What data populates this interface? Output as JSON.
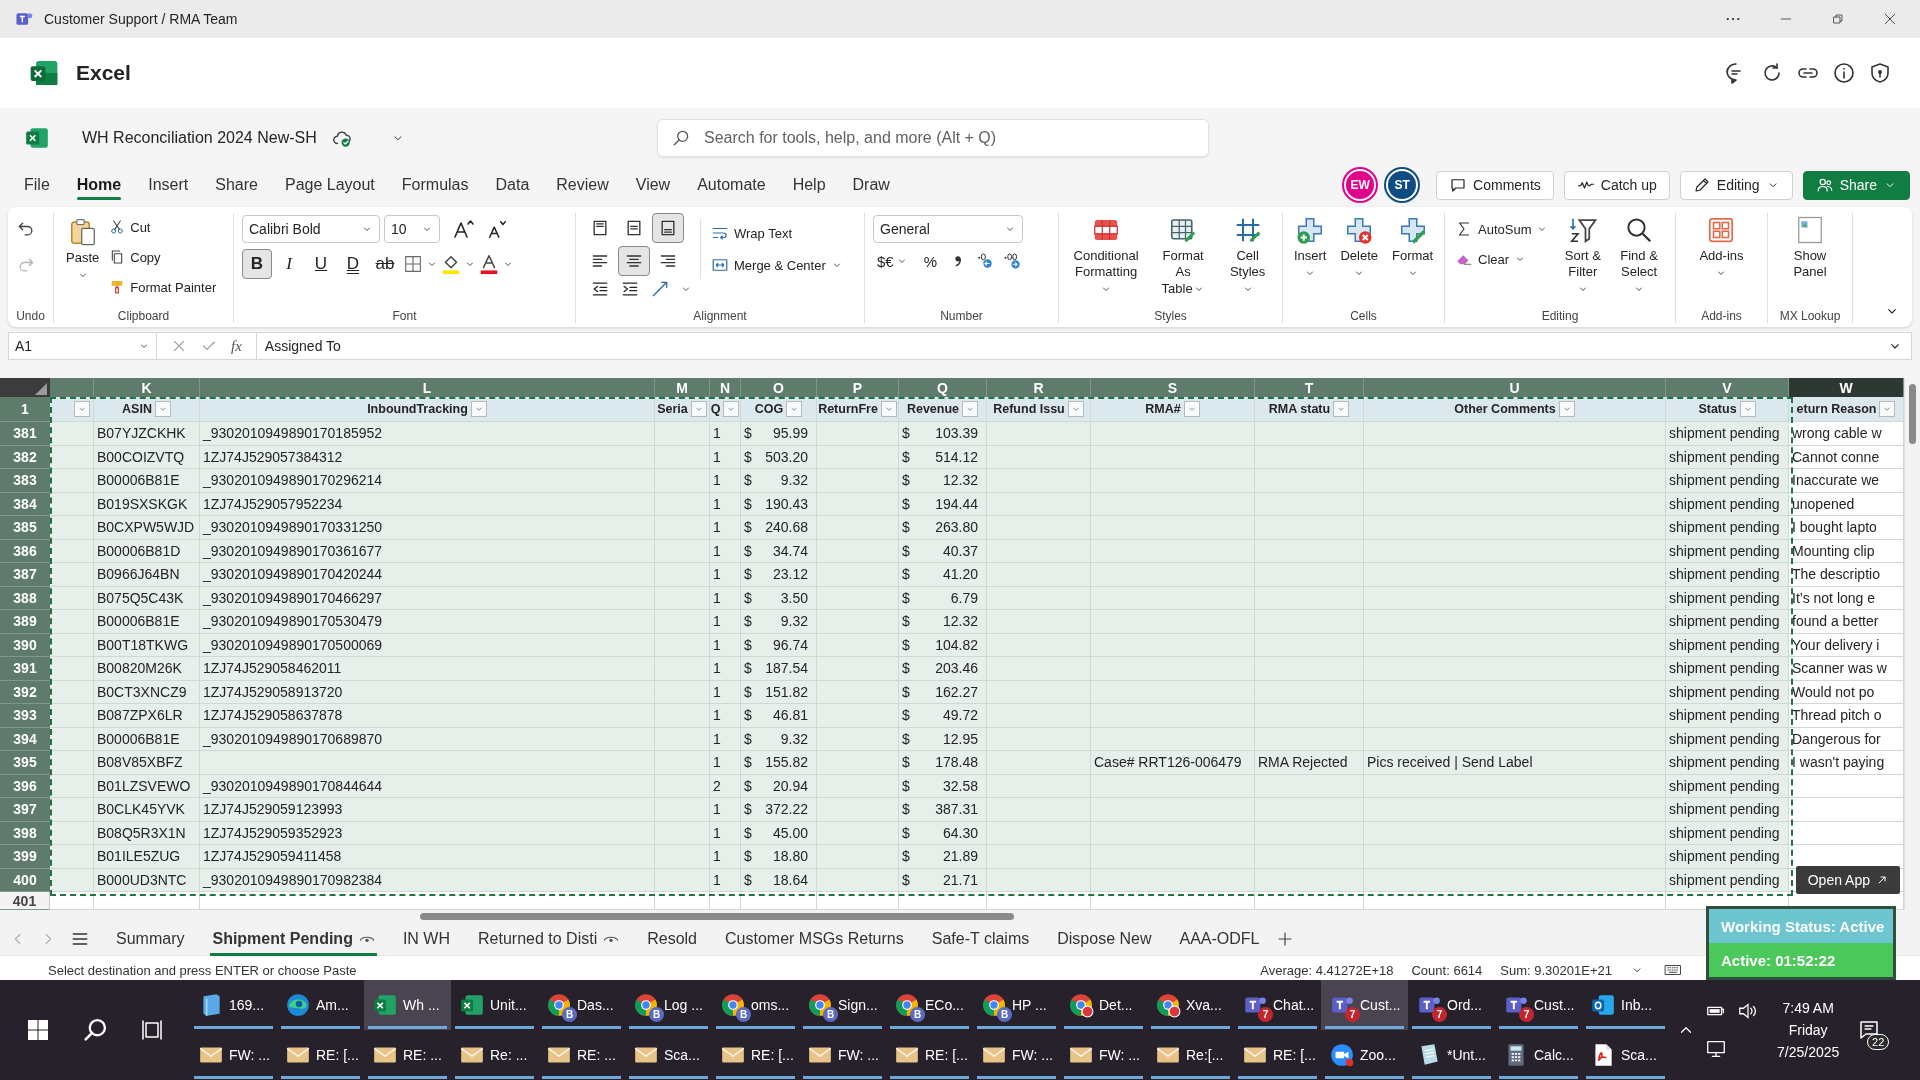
{
  "title_bar": {
    "title": "Customer Support / RMA Team"
  },
  "app_header": {
    "app_name": "Excel"
  },
  "file_bar": {
    "file_name": "WH Reconciliation 2024 New-SH",
    "search": {
      "placeholder": "Search for tools, help, and more (Alt + Q)"
    }
  },
  "menu_tabs": [
    {
      "label": "File",
      "selected": false
    },
    {
      "label": "Home",
      "selected": true
    },
    {
      "label": "Insert",
      "selected": false
    },
    {
      "label": "Share",
      "selected": false
    },
    {
      "label": "Page Layout",
      "selected": false
    },
    {
      "label": "Formulas",
      "selected": false
    },
    {
      "label": "Data",
      "selected": false
    },
    {
      "label": "Review",
      "selected": false
    },
    {
      "label": "View",
      "selected": false
    },
    {
      "label": "Automate",
      "selected": false
    },
    {
      "label": "Help",
      "selected": false
    },
    {
      "label": "Draw",
      "selected": false
    }
  ],
  "collaborators": [
    {
      "initials": "EW",
      "color": "#e3008c"
    },
    {
      "initials": "ST",
      "color": "#0f4c81"
    }
  ],
  "header_buttons": [
    {
      "kind": "comments",
      "label": "Comments"
    },
    {
      "kind": "catchup",
      "label": "Catch up"
    },
    {
      "kind": "editing",
      "label": "Editing"
    },
    {
      "kind": "share",
      "label": "Share"
    }
  ],
  "ribbon": {
    "groups": [
      {
        "kind": "undo",
        "label": "Undo",
        "redo_disabled": true
      },
      {
        "kind": "clipboard",
        "label": "Clipboard",
        "paste": "Paste",
        "items": [
          {
            "kind": "cut",
            "label": "Cut"
          },
          {
            "kind": "copy",
            "label": "Copy"
          },
          {
            "kind": "painter",
            "label": "Format Painter"
          }
        ]
      },
      {
        "kind": "font",
        "label": "Font",
        "font_name": "Calibri Bold",
        "font_size": "10",
        "format_buttons": [
          {
            "kind": "bold",
            "label": "B",
            "selected": true
          },
          {
            "kind": "italic",
            "label": "I",
            "selected": false
          },
          {
            "kind": "underline",
            "label": "U",
            "selected": false
          },
          {
            "kind": "double_underline",
            "label": "D",
            "selected": false
          },
          {
            "kind": "strike",
            "label": "ab",
            "selected": false
          }
        ]
      },
      {
        "kind": "alignment",
        "label": "Alignment",
        "vertical": [
          {
            "kind": "top",
            "selected": false
          },
          {
            "kind": "middle",
            "selected": false
          },
          {
            "kind": "bottom",
            "selected": true
          }
        ],
        "horizontal": [
          {
            "kind": "left",
            "selected": false
          },
          {
            "kind": "center",
            "selected": true
          },
          {
            "kind": "right",
            "selected": false
          }
        ],
        "wrap": "Wrap Text",
        "merge": "Merge & Center"
      },
      {
        "kind": "number",
        "label": "Number",
        "format": "General",
        "currency": "$€",
        "percent": "%"
      },
      {
        "kind": "large",
        "label": "Styles",
        "buttons": [
          {
            "kind": "conditional",
            "label": "Conditional\nFormatting"
          },
          {
            "kind": "table",
            "label": "Format As\nTable"
          },
          {
            "kind": "cellstyles",
            "label": "Cell\nStyles"
          }
        ]
      },
      {
        "kind": "large",
        "label": "Cells",
        "buttons": [
          {
            "kind": "insert",
            "label": "Insert"
          },
          {
            "kind": "delete",
            "label": "Delete"
          },
          {
            "kind": "format",
            "label": "Format"
          }
        ]
      },
      {
        "kind": "editing",
        "label": "Editing",
        "small": [
          {
            "kind": "autosum",
            "label": "AutoSum"
          },
          {
            "kind": "clear",
            "label": "Clear"
          }
        ],
        "buttons": [
          {
            "kind": "sort",
            "label": "Sort &\nFilter"
          },
          {
            "kind": "find",
            "label": "Find &\nSelect"
          }
        ]
      },
      {
        "kind": "large",
        "label": "Add-ins",
        "buttons": [
          {
            "kind": "addins",
            "label": "Add-ins"
          }
        ]
      },
      {
        "kind": "large",
        "label": "MX Lookup",
        "buttons": [
          {
            "kind": "panel",
            "label": "Show\nPanel"
          }
        ]
      }
    ]
  },
  "formula_bar": {
    "name_box": "A1",
    "function_label": "fx",
    "content": "Assigned To"
  },
  "sheet": {
    "columns": [
      {
        "kind": "text",
        "selected": true
      },
      {
        "letter": "K",
        "header": "ASIN",
        "kind": "text",
        "selected": true
      },
      {
        "letter": "L",
        "header": "InboundTracking",
        "kind": "text",
        "selected": true
      },
      {
        "letter": "M",
        "header": "Seria",
        "kind": "text",
        "selected": true
      },
      {
        "letter": "N",
        "header": "Q",
        "kind": "text",
        "selected": true
      },
      {
        "letter": "O",
        "header": "COG",
        "kind": "currency",
        "selected": true
      },
      {
        "letter": "P",
        "header": "ReturnFre",
        "kind": "text",
        "selected": true
      },
      {
        "letter": "Q",
        "header": "Revenue",
        "kind": "currency",
        "selected": true
      },
      {
        "letter": "R",
        "header": "Refund Issu",
        "kind": "text",
        "selected": true
      },
      {
        "letter": "S",
        "header": "RMA#",
        "kind": "text",
        "selected": true
      },
      {
        "letter": "T",
        "header": "RMA statu",
        "kind": "text",
        "selected": true
      },
      {
        "letter": "U",
        "header": "Other Comments",
        "kind": "text",
        "selected": true
      },
      {
        "letter": "V",
        "header": "Status",
        "kind": "text",
        "selected": true
      },
      {
        "letter": "W",
        "header": "eturn Reason",
        "kind": "text",
        "selected": false
      }
    ],
    "header_row": "1",
    "rows": [
      {
        "num": "381",
        "selected": true,
        "asin": "B07YJZCKHK",
        "tracking": "_9302010949890170185952",
        "qty": "1",
        "cog_currency": "$",
        "cog": "95.99",
        "revenue_currency": "$",
        "revenue": "103.39",
        "status": "shipment pending",
        "reason": "wrong cable w"
      },
      {
        "num": "382",
        "selected": true,
        "asin": "B00COIZVTQ",
        "tracking": "1ZJ74J529057384312",
        "qty": "1",
        "cog_currency": "$",
        "cog": "503.20",
        "revenue_currency": "$",
        "revenue": "514.12",
        "status": "shipment pending",
        "reason": "Cannot conne"
      },
      {
        "num": "383",
        "selected": true,
        "asin": "B00006B81E",
        "tracking": "_9302010949890170296214",
        "qty": "1",
        "cog_currency": "$",
        "cog": "9.32",
        "revenue_currency": "$",
        "revenue": "12.32",
        "status": "shipment pending",
        "reason": "Inaccurate we"
      },
      {
        "num": "384",
        "selected": true,
        "asin": "B019SXSKGK",
        "tracking": "1ZJ74J529057952234",
        "qty": "1",
        "cog_currency": "$",
        "cog": "190.43",
        "revenue_currency": "$",
        "revenue": "194.44",
        "status": "shipment pending",
        "reason": "unopened"
      },
      {
        "num": "385",
        "selected": true,
        "asin": "B0CXPW5WJD",
        "tracking": "_9302010949890170331250",
        "qty": "1",
        "cog_currency": "$",
        "cog": "240.68",
        "revenue_currency": "$",
        "revenue": "263.80",
        "status": "shipment pending",
        "reason": "I bought lapto"
      },
      {
        "num": "386",
        "selected": true,
        "asin": "B00006B81D",
        "tracking": "_9302010949890170361677",
        "qty": "1",
        "cog_currency": "$",
        "cog": "34.74",
        "revenue_currency": "$",
        "revenue": "40.37",
        "status": "shipment pending",
        "reason": "Mounting clip"
      },
      {
        "num": "387",
        "selected": true,
        "asin": "B0966J64BN",
        "tracking": "_9302010949890170420244",
        "qty": "1",
        "cog_currency": "$",
        "cog": "23.12",
        "revenue_currency": "$",
        "revenue": "41.20",
        "status": "shipment pending",
        "reason": "The descriptio"
      },
      {
        "num": "388",
        "selected": true,
        "asin": "B075Q5C43K",
        "tracking": "_9302010949890170466297",
        "qty": "1",
        "cog_currency": "$",
        "cog": "3.50",
        "revenue_currency": "$",
        "revenue": "6.79",
        "status": "shipment pending",
        "reason": "It’s not long e"
      },
      {
        "num": "389",
        "selected": true,
        "asin": "B00006B81E",
        "tracking": "_9302010949890170530479",
        "qty": "1",
        "cog_currency": "$",
        "cog": "9.32",
        "revenue_currency": "$",
        "revenue": "12.32",
        "status": "shipment pending",
        "reason": "found a better"
      },
      {
        "num": "390",
        "selected": true,
        "asin": "B00T18TKWG",
        "tracking": "_9302010949890170500069",
        "qty": "1",
        "cog_currency": "$",
        "cog": "96.74",
        "revenue_currency": "$",
        "revenue": "104.82",
        "status": "shipment pending",
        "reason": "Your delivery i"
      },
      {
        "num": "391",
        "selected": true,
        "asin": "B00820M26K",
        "tracking": "1ZJ74J529058462011",
        "qty": "1",
        "cog_currency": "$",
        "cog": "187.54",
        "revenue_currency": "$",
        "revenue": "203.46",
        "status": "shipment pending",
        "reason": "Scanner was w"
      },
      {
        "num": "392",
        "selected": true,
        "asin": "B0CT3XNCZ9",
        "tracking": "1ZJ74J529058913720",
        "qty": "1",
        "cog_currency": "$",
        "cog": "151.82",
        "revenue_currency": "$",
        "revenue": "162.27",
        "status": "shipment pending",
        "reason": "Would not po"
      },
      {
        "num": "393",
        "selected": true,
        "asin": "B087ZPX6LR",
        "tracking": "1ZJ74J529058637878",
        "qty": "1",
        "cog_currency": "$",
        "cog": "46.81",
        "revenue_currency": "$",
        "revenue": "49.72",
        "status": "shipment pending",
        "reason": "Thread pitch o"
      },
      {
        "num": "394",
        "selected": true,
        "asin": "B00006B81E",
        "tracking": "_9302010949890170689870",
        "qty": "1",
        "cog_currency": "$",
        "cog": "9.32",
        "revenue_currency": "$",
        "revenue": "12.95",
        "status": "shipment pending",
        "reason": "Dangerous for"
      },
      {
        "num": "395",
        "selected": true,
        "asin": "B08V85XBFZ",
        "qty": "1",
        "cog_currency": "$",
        "cog": "155.82",
        "revenue_currency": "$",
        "revenue": "178.48",
        "rma": "Case# RRT126-006479",
        "rma_status": "RMA Rejected",
        "comments": "Pics received | Send Label",
        "status": "shipment pending",
        "reason": "I wasn't paying"
      },
      {
        "num": "396",
        "selected": true,
        "asin": "B01LZSVEWO",
        "tracking": "_9302010949890170844644",
        "qty": "2",
        "cog_currency": "$",
        "cog": "20.94",
        "revenue_currency": "$",
        "revenue": "32.58",
        "status": "shipment pending"
      },
      {
        "num": "397",
        "selected": true,
        "asin": "B0CLK45YVK",
        "tracking": "1ZJ74J529059123993",
        "qty": "1",
        "cog_currency": "$",
        "cog": "372.22",
        "revenue_currency": "$",
        "revenue": "387.31",
        "status": "shipment pending"
      },
      {
        "num": "398",
        "selected": true,
        "asin": "B08Q5R3X1N",
        "tracking": "1ZJ74J529059352923",
        "qty": "1",
        "cog_currency": "$",
        "cog": "45.00",
        "revenue_currency": "$",
        "revenue": "64.30",
        "status": "shipment pending"
      },
      {
        "num": "399",
        "selected": true,
        "asin": "B01ILE5ZUG",
        "tracking": "1ZJ74J529059411458",
        "qty": "1",
        "cog_currency": "$",
        "cog": "18.80",
        "revenue_currency": "$",
        "revenue": "21.89",
        "status": "shipment pending"
      },
      {
        "num": "400",
        "selected": true,
        "asin": "B000UD3NTC",
        "tracking": "_9302010949890170982384",
        "qty": "1",
        "cog_currency": "$",
        "cog": "18.64",
        "revenue_currency": "$",
        "revenue": "21.71",
        "status": "shipment pending"
      },
      {
        "num": "401",
        "selected": false
      }
    ]
  },
  "sheet_tabs": [
    {
      "label": "Summary",
      "selected": false,
      "view_icon": false
    },
    {
      "label": "Shipment Pending",
      "selected": true,
      "view_icon": true
    },
    {
      "label": "IN WH",
      "selected": false,
      "view_icon": false
    },
    {
      "label": "Returned to Disti",
      "selected": false,
      "view_icon": true
    },
    {
      "label": "Resold",
      "selected": false,
      "view_icon": false
    },
    {
      "label": "Customer MSGs Returns",
      "selected": false,
      "view_icon": false
    },
    {
      "label": "Safe-T claims",
      "selected": false,
      "view_icon": false
    },
    {
      "label": "Dispose New",
      "selected": false,
      "view_icon": false
    },
    {
      "label": "AAA-ODFL",
      "selected": false,
      "view_icon": false
    }
  ],
  "status_bar": {
    "message": "Select destination and press ENTER or choose Paste",
    "average": "Average: 4.41272E+18",
    "count": "Count: 6614",
    "sum": "Sum: 9.30201E+21"
  },
  "overlay": {
    "open_app": "Open App",
    "working_status": "Working Status: Active",
    "timer": "Active: 01:52:22"
  },
  "taskbar": {
    "top_row": [
      {
        "kind": "box",
        "label": "169...",
        "selected": false
      },
      {
        "kind": "edge",
        "label": "Am...",
        "selected": false
      },
      {
        "kind": "excel",
        "label": "Wh ...",
        "selected": true
      },
      {
        "kind": "excel",
        "label": "Unit...",
        "selected": false
      },
      {
        "kind": "chrome",
        "label": "Das...",
        "badge": "B",
        "selected": false
      },
      {
        "kind": "chrome",
        "label": "Log ...",
        "badge": "B",
        "selected": false
      },
      {
        "kind": "chrome",
        "label": "oms...",
        "badge": "B",
        "selected": false
      },
      {
        "kind": "chrome",
        "label": "Sign...",
        "badge": "B",
        "selected": false
      },
      {
        "kind": "chrome",
        "label": "ECo...",
        "badge": "B",
        "selected": false
      },
      {
        "kind": "chrome",
        "label": "HP ...",
        "badge": "B",
        "selected": false
      },
      {
        "kind": "chrome_alert",
        "label": "Det...",
        "selected": false
      },
      {
        "kind": "chrome_alert",
        "label": "Xva...",
        "selected": false
      },
      {
        "kind": "teams",
        "label": "Chat...",
        "badge": "7",
        "selected": false
      },
      {
        "kind": "teams",
        "label": "Cust...",
        "badge": "7",
        "selected": true
      },
      {
        "kind": "teams",
        "label": "Ord...",
        "badge": "7",
        "selected": false
      },
      {
        "kind": "teams",
        "label": "Cust...",
        "badge": "7",
        "selected": false
      },
      {
        "kind": "outlook",
        "label": "Inb...",
        "selected": false
      }
    ],
    "bottom_row": [
      {
        "kind": "mail",
        "label": "FW: ...",
        "selected": false
      },
      {
        "kind": "mail",
        "label": "RE: [...",
        "selected": false
      },
      {
        "kind": "mail",
        "label": "RE: ...",
        "selected": false
      },
      {
        "kind": "mail",
        "label": "Re: ...",
        "selected": false
      },
      {
        "kind": "mail",
        "label": "RE: ...",
        "selected": false
      },
      {
        "kind": "mail",
        "label": "Sca...",
        "selected": false
      },
      {
        "kind": "mail",
        "label": "RE: [...",
        "selected": false
      },
      {
        "kind": "mail",
        "label": "FW: ...",
        "selected": false
      },
      {
        "kind": "mail",
        "label": "RE: [...",
        "selected": false
      },
      {
        "kind": "mail",
        "label": "FW: ...",
        "selected": false
      },
      {
        "kind": "mail",
        "label": "FW: ...",
        "selected": false
      },
      {
        "kind": "mail",
        "label": "Re:[...",
        "selected": false
      },
      {
        "kind": "mail",
        "label": "RE: [...",
        "selected": false
      },
      {
        "kind": "zoom",
        "label": "Zoo...",
        "selected": false
      },
      {
        "kind": "notepad",
        "label": "*Unt...",
        "selected": false
      },
      {
        "kind": "calculator",
        "label": "Calc...",
        "selected": false
      },
      {
        "kind": "pdf",
        "label": "Sca...",
        "selected": false
      }
    ],
    "time": "7:49 AM",
    "day": "Friday",
    "date": "7/25/2025",
    "notifications": "22"
  }
}
